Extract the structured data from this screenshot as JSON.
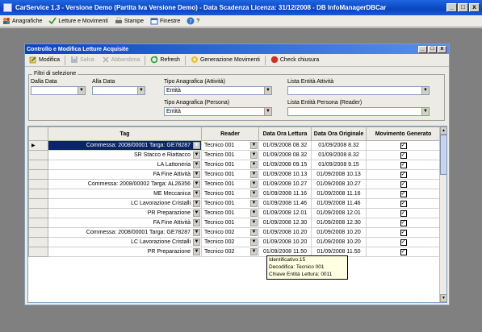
{
  "app": {
    "title": "CarService 1.3 - Versione Demo (Partita Iva Versione Demo) - Data Scadenza Licenza: 31/12/2008 - DB InfoManagerDBCar",
    "win_buttons": [
      "_",
      "□",
      "x"
    ]
  },
  "menu": [
    {
      "label": "Anagrafiche",
      "icon": "people-icon"
    },
    {
      "label": "Letture e Movimenti",
      "icon": "checklist-icon"
    },
    {
      "label": "Stampe",
      "icon": "printer-icon"
    },
    {
      "label": "Finestre",
      "icon": "windows-icon"
    },
    {
      "label": "?",
      "icon": "help-icon"
    }
  ],
  "child": {
    "title": "Controllo e Modifica Letture Acquisite",
    "win_buttons": [
      "_",
      "□",
      "x"
    ]
  },
  "toolbar": {
    "modifica": "Modifica",
    "salva": "Salva",
    "abbandona": "Abbandona",
    "refresh": "Refresh",
    "generazione": "Generazione Movimenti",
    "check": "Check chiusura"
  },
  "filters": {
    "legend": "Filtri di selezione",
    "dalla_data": "Dalla Data",
    "alla_data": "Alla Data",
    "tipo_anagrafica_attivita": "Tipo Anagrafica (Attività)",
    "tipo_anagrafica_attivita_value": "Entità",
    "lista_entita_attivita": "Lista Entità Attività",
    "tipo_anagrafica_persona": "Tipo Anagrafica (Persona)",
    "tipo_anagrafica_persona_value": "Entità",
    "lista_entita_persona": "Lista Entità Persona (Reader)"
  },
  "grid": {
    "headers": {
      "tag": "Tag",
      "reader": "Reader",
      "data_lettura": "Data Ora Lettura",
      "data_originale": "Data Ora Originale",
      "movimento": "Movimento Generato"
    },
    "rows": [
      {
        "tag": "Commessa: 2008/00001 Targa: GE78287",
        "reader": "Tecnico 001",
        "lettura": "01/09/2008 08.32",
        "originale": "01/09/2008 8.32",
        "generato": true,
        "active": true
      },
      {
        "tag": "SR Stacco e Riattacco",
        "reader": "Tecnico 001",
        "lettura": "01/09/2008 08.32",
        "originale": "01/09/2008 8.32",
        "generato": true
      },
      {
        "tag": "LA Lattoneria",
        "reader": "Tecnico 001",
        "lettura": "01/09/2008 09.15",
        "originale": "01/09/2008 9.15",
        "generato": true
      },
      {
        "tag": "FA Fine Attività",
        "reader": "Tecnico 001",
        "lettura": "01/09/2008 10.13",
        "originale": "01/09/2008 10.13",
        "generato": true
      },
      {
        "tag": "Commessa: 2008/00002 Targa: AL26356",
        "reader": "Tecnico 001",
        "lettura": "01/09/2008 10.27",
        "originale": "01/09/2008 10.27",
        "generato": true
      },
      {
        "tag": "ME Meccanica",
        "reader": "Tecnico 001",
        "lettura": "01/09/2008 11.16",
        "originale": "01/09/2008 11.16",
        "generato": true
      },
      {
        "tag": "LC Lavorazione Cristalli",
        "reader": "Tecnico 001",
        "lettura": "01/09/2008 11.46",
        "originale": "01/09/2008 11.46",
        "generato": true
      },
      {
        "tag": "PR Preparazione",
        "reader": "Tecnico 001",
        "lettura": "01/09/2008 12.01",
        "originale": "01/09/2008 12.01",
        "generato": true
      },
      {
        "tag": "FA Fine Attività",
        "reader": "Tecnico 001",
        "lettura": "01/09/2008 12.30",
        "originale": "01/09/2008 12.30",
        "generato": true
      },
      {
        "tag": "Commessa: 2008/00001 Targa: GE78287",
        "reader": "Tecnico 002",
        "lettura": "01/09/2008 10.20",
        "originale": "01/09/2008 10.20",
        "generato": true
      },
      {
        "tag": "LC Lavorazione Cristalli",
        "reader": "Tecnico 002",
        "lettura": "01/09/2008 10.20",
        "originale": "01/09/2008 10.20",
        "generato": true
      },
      {
        "tag": "PR Preparazione",
        "reader": "Tecnico 002",
        "lettura": "01/09/2008 11.50",
        "originale": "01/09/2008 11.50",
        "generato": true
      }
    ]
  },
  "tooltip": {
    "line1": "Identificativo:15",
    "line2": "Decodifica: Tecnico 001",
    "line3": "Chiave Entità Lettura: 0011"
  }
}
